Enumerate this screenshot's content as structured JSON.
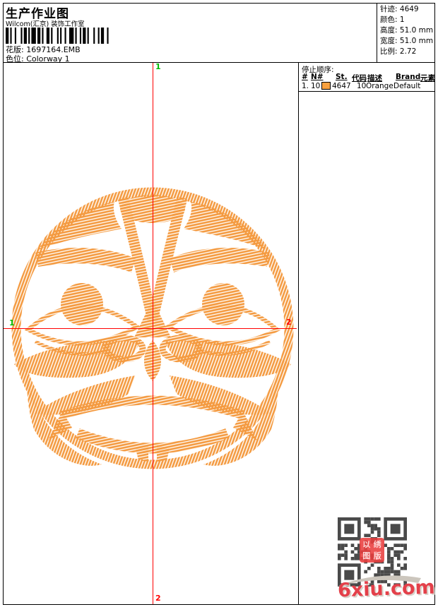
{
  "header": {
    "title": "生产作业图",
    "company": "Wilcom(汇京) 装饰工作室",
    "design_label": "花版:",
    "design_value": "1697164.EMB",
    "colorway_label": "色位:",
    "colorway_value": "Colorway 1"
  },
  "summary": {
    "stitches_label": "针迹:",
    "stitches_value": "4649",
    "colors_label": "颜色:",
    "colors_value": "1",
    "height_label": "高度:",
    "height_value": "51.0 mm",
    "width_label": "宽度:",
    "width_value": "51.0 mm",
    "ratio_label": "比例:",
    "ratio_value": "2.72"
  },
  "stop_sequence": {
    "title": "停止顺序:",
    "columns": [
      "#",
      "N#",
      "St.",
      "代码",
      "描述",
      "Brand",
      "元素"
    ],
    "rows": [
      {
        "index": "1.",
        "needle": "10",
        "swatch_color": "#F9A13F",
        "stitches": "4647",
        "code": "10",
        "description": "Orange",
        "brand": "Default",
        "elements": ""
      }
    ]
  },
  "design": {
    "thread_color": "#F49A40",
    "crosshair_color": "#FF0000",
    "start_marker": "1",
    "end_marker": "2",
    "start_marker_color": "#00BB00",
    "end_marker_color": "#FF0000"
  },
  "watermark": {
    "site": "6xiu.com",
    "site_color": "#E4404A",
    "stamp_chars": [
      "以",
      "绣",
      "图",
      "版"
    ]
  }
}
